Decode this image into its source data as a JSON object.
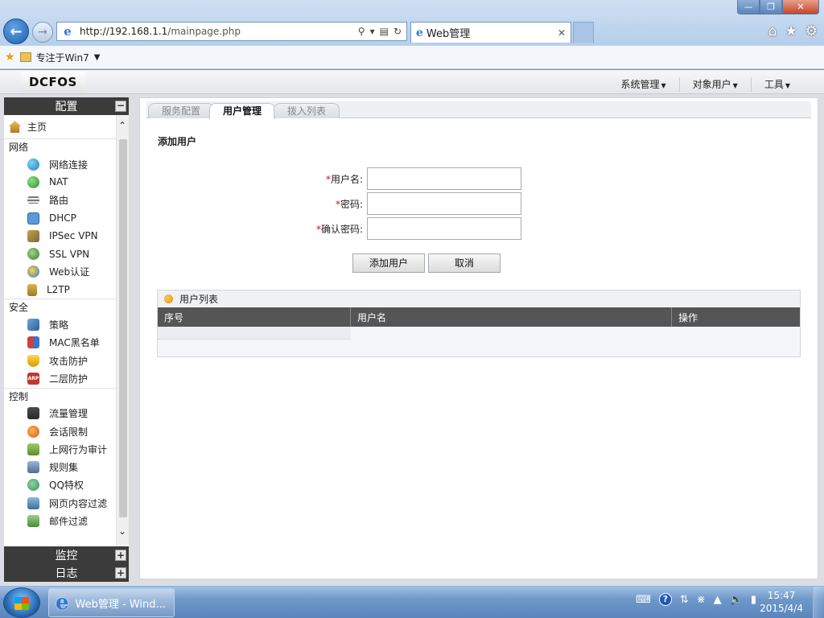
{
  "browser": {
    "url_host": "http://192.168.1.1",
    "url_path": "/mainpage.php",
    "tab_title": "Web管理",
    "fav_item": "专注于Win7"
  },
  "header": {
    "logo": "DCFOS",
    "menus": [
      "系统管理",
      "对象用户",
      "工具"
    ]
  },
  "sidebar": {
    "title": "配置",
    "home": "主页",
    "groups": [
      {
        "title": "网络",
        "items": [
          "网络连接",
          "NAT",
          "路由",
          "DHCP",
          "IPSec VPN",
          "SSL VPN",
          "Web认证",
          "L2TP"
        ]
      },
      {
        "title": "安全",
        "items": [
          "策略",
          "MAC黑名单",
          "攻击防护",
          "二层防护"
        ]
      },
      {
        "title": "控制",
        "items": [
          "流量管理",
          "会话限制",
          "上网行为审计",
          "规则集",
          "QQ特权",
          "网页内容过滤",
          "邮件过滤"
        ]
      }
    ],
    "footers": [
      "监控",
      "日志"
    ]
  },
  "main": {
    "tabs": [
      "服务配置",
      "用户管理",
      "拨入列表"
    ],
    "active_tab": "用户管理",
    "section_title": "添加用户",
    "fields": [
      {
        "label": "用户名:",
        "value": ""
      },
      {
        "label": "密码:",
        "value": ""
      },
      {
        "label": "确认密码:",
        "value": ""
      }
    ],
    "add_button": "添加用户",
    "cancel_button": "取消",
    "list_title": "用户列表",
    "columns": [
      "序号",
      "用户名",
      "操作"
    ]
  },
  "taskbar": {
    "task_label": "Web管理 - Wind...",
    "time": "15:47",
    "date": "2015/4/4"
  }
}
